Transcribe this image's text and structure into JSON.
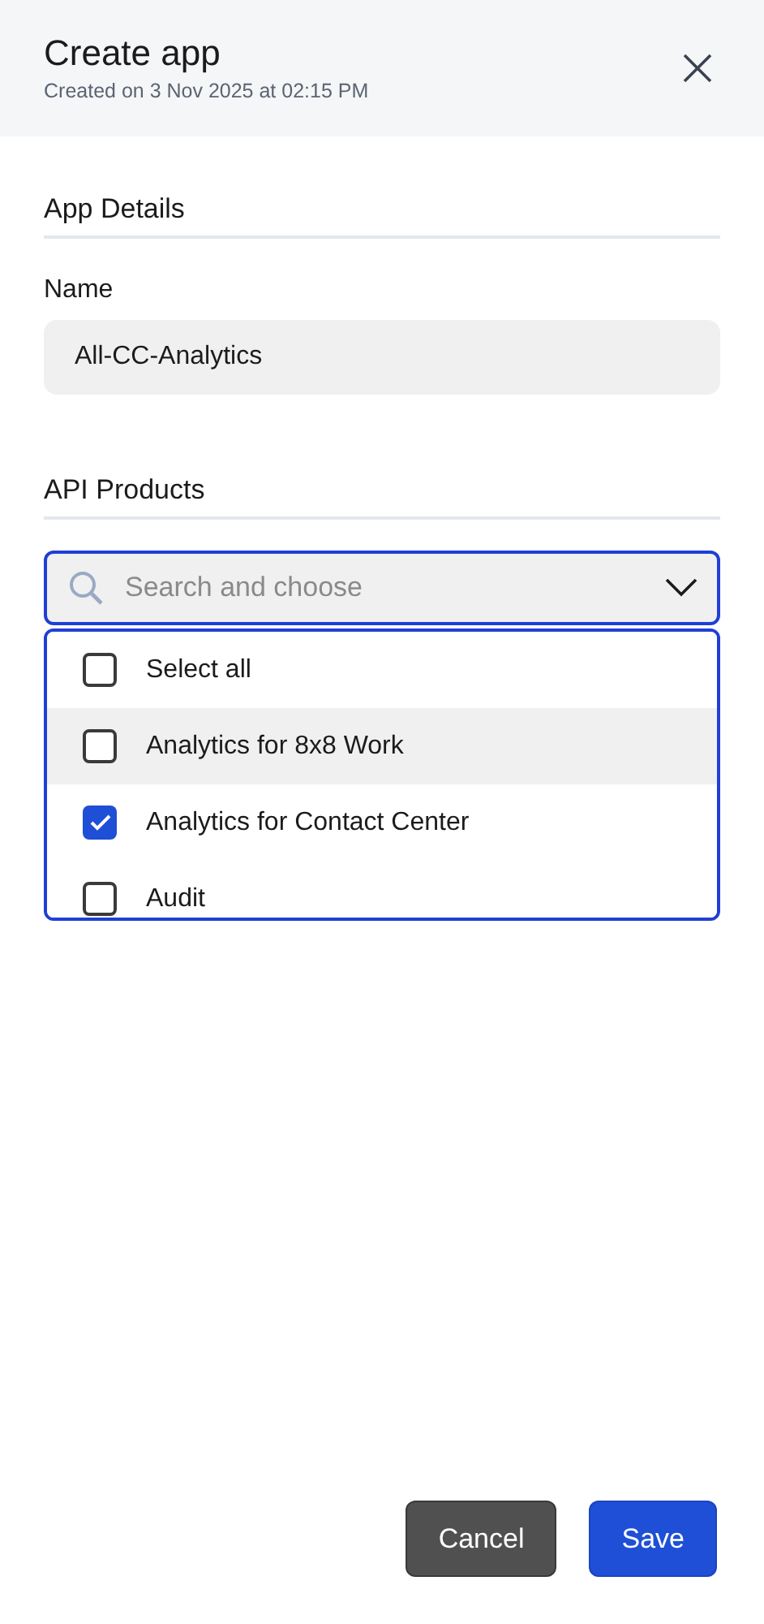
{
  "header": {
    "title": "Create app",
    "subtitle": "Created on 3 Nov 2025 at 02:15 PM"
  },
  "sections": [
    {
      "heading": "App Details"
    },
    {
      "heading": "API Products"
    }
  ],
  "name_field": {
    "label": "Name",
    "value": "All-CC-Analytics"
  },
  "products_select": {
    "placeholder": "Search and choose",
    "expanded": true,
    "options": [
      {
        "label": "Select all",
        "checked": false,
        "highlighted": false
      },
      {
        "label": "Analytics for 8x8 Work",
        "checked": false,
        "highlighted": true
      },
      {
        "label": "Analytics for Contact Center",
        "checked": true,
        "highlighted": false
      },
      {
        "label": "Audit",
        "checked": false,
        "highlighted": false
      }
    ]
  },
  "buttons": [
    {
      "label": "Cancel",
      "kind": "secondary"
    },
    {
      "label": "Save",
      "kind": "primary"
    }
  ]
}
